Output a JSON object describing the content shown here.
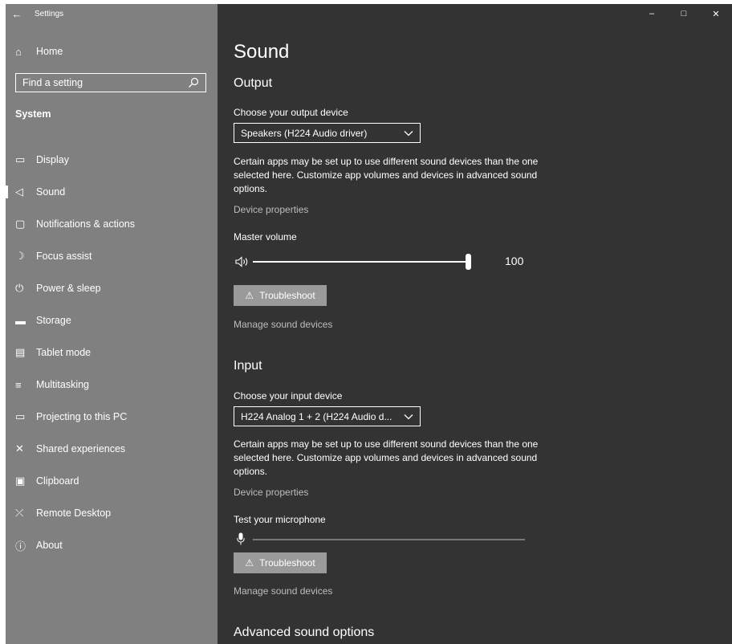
{
  "window": {
    "app_title": "Settings",
    "back_icon": "←",
    "minimize": "–",
    "maximize": "□",
    "close": "✕"
  },
  "sidebar": {
    "home_icon": "⌂",
    "home_label": "Home",
    "search_placeholder": "Find a setting",
    "section_title": "System",
    "items": [
      {
        "icon": "▭",
        "label": "Display"
      },
      {
        "icon": "◁",
        "label": "Sound",
        "selected": true
      },
      {
        "icon": "▢",
        "label": "Notifications & actions"
      },
      {
        "icon": "☽",
        "label": "Focus assist"
      },
      {
        "icon": "⏻",
        "label": "Power & sleep"
      },
      {
        "icon": "▬",
        "label": "Storage"
      },
      {
        "icon": "▤",
        "label": "Tablet mode"
      },
      {
        "icon": "≡",
        "label": "Multitasking"
      },
      {
        "icon": "▭",
        "label": "Projecting to this PC"
      },
      {
        "icon": "✕",
        "label": "Shared experiences"
      },
      {
        "icon": "▣",
        "label": "Clipboard"
      },
      {
        "icon": "⤫",
        "label": "Remote Desktop"
      },
      {
        "icon": "ⓘ",
        "label": "About"
      }
    ]
  },
  "main": {
    "page_title": "Sound",
    "output": {
      "heading": "Output",
      "device_label": "Choose your output device",
      "device_value": "Speakers (H224 Audio driver)",
      "description": "Certain apps may be set up to use different sound devices than the one selected here. Customize app volumes and devices in advanced sound options.",
      "device_properties": "Device properties",
      "volume_label": "Master volume",
      "volume_value": "100",
      "volume_level": 1.0,
      "troubleshoot": "Troubleshoot",
      "manage_devices": "Manage sound devices"
    },
    "input": {
      "heading": "Input",
      "device_label": "Choose your input device",
      "device_value": "H224 Analog 1 + 2 (H224 Audio d...",
      "description": "Certain apps may be set up to use different sound devices than the one selected here. Customize app volumes and devices in advanced sound options.",
      "device_properties": "Device properties",
      "test_label": "Test your microphone",
      "mic_level": 0.0,
      "troubleshoot": "Troubleshoot",
      "manage_devices": "Manage sound devices"
    },
    "advanced_heading": "Advanced sound options"
  },
  "colors": {
    "sidebar_bg": "#808080",
    "main_bg": "#333333",
    "button_bg": "#9a9a9a",
    "link": "#bdbdbd"
  }
}
